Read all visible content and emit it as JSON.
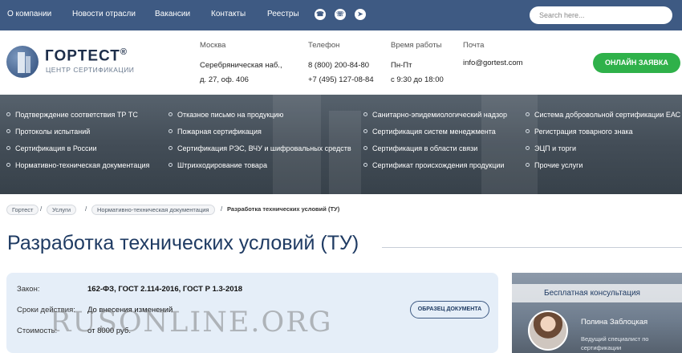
{
  "topnav": {
    "links": [
      "О компании",
      "Новости отрасли",
      "Вакансии",
      "Контакты",
      "Реестры"
    ],
    "social_icons": [
      "whatsapp-icon",
      "viber-icon",
      "telegram-icon"
    ],
    "search_placeholder": "Search here..."
  },
  "header": {
    "logo_name": "ГОРТЕСТ",
    "logo_reg": "®",
    "logo_sub": "ЦЕНТР СЕРТИФИКАЦИИ",
    "address_label": "Москва",
    "address_line1": "Серебряническая наб.,",
    "address_line2": "д. 27, оф. 406",
    "phone_label": "Телефон",
    "phone1": "8 (800) 200-84-80",
    "phone2": "+7 (495) 127-08-84",
    "hours_label": "Время работы",
    "hours_days": "Пн-Пт",
    "hours_time": "с 9:30 до 18:00",
    "mail_label": "Почта",
    "email": "info@gortest.com",
    "cta_label": "ОНЛАЙН ЗАЯВКА"
  },
  "services": {
    "col1": [
      "Подтверждение соответствия ТР ТС",
      "Протоколы испытаний",
      "Сертификация в России",
      "Нормативно-техническая документация"
    ],
    "col2": [
      "Отказное письмо на продукцию",
      "Пожарная сертификация",
      "Сертификация РЭС, ВЧУ и шифровальных средств",
      "Штрихкодирование товара"
    ],
    "col3": [
      "Санитарно-эпидемиологический надзор",
      "Сертификация систем менеджмента",
      "Сертификация в области связи",
      "Сертификат происхождения продукции"
    ],
    "col4": [
      "Система добровольной сертификации ЕАС",
      "Регистрация товарного знака",
      "ЭЦП и торги",
      "Прочие услуги"
    ]
  },
  "breadcrumb": {
    "items": [
      "Гортест",
      "Услуги",
      "Нормативно-техническая документация"
    ],
    "separator": "/",
    "current": "Разработка технических условий (ТУ)"
  },
  "page": {
    "title": "Разработка технических условий (ТУ)"
  },
  "info": {
    "law_label": "Закон:",
    "law_value": "162-ФЗ, ГОСТ 2.114-2016, ГОСТ Р 1.3-2018",
    "term_label": "Сроки действия:",
    "term_value": "До внесения изменений",
    "price_label": "Стоимость:",
    "price_value": "от 8000 руб.",
    "doc_button": "ОБРАЗЕЦ ДОКУМЕНТА"
  },
  "watermark": "RUSONLINE.ORG",
  "consult": {
    "heading": "Бесплатная консультация",
    "name": "Полина Заблоцкая",
    "role_line1": "Ведущий специалист по",
    "role_line2": "сертификации"
  },
  "colors": {
    "topbar": "#3e5a83",
    "cta": "#2fb14a",
    "title": "#1f3b63",
    "card": "#e5eef8"
  }
}
